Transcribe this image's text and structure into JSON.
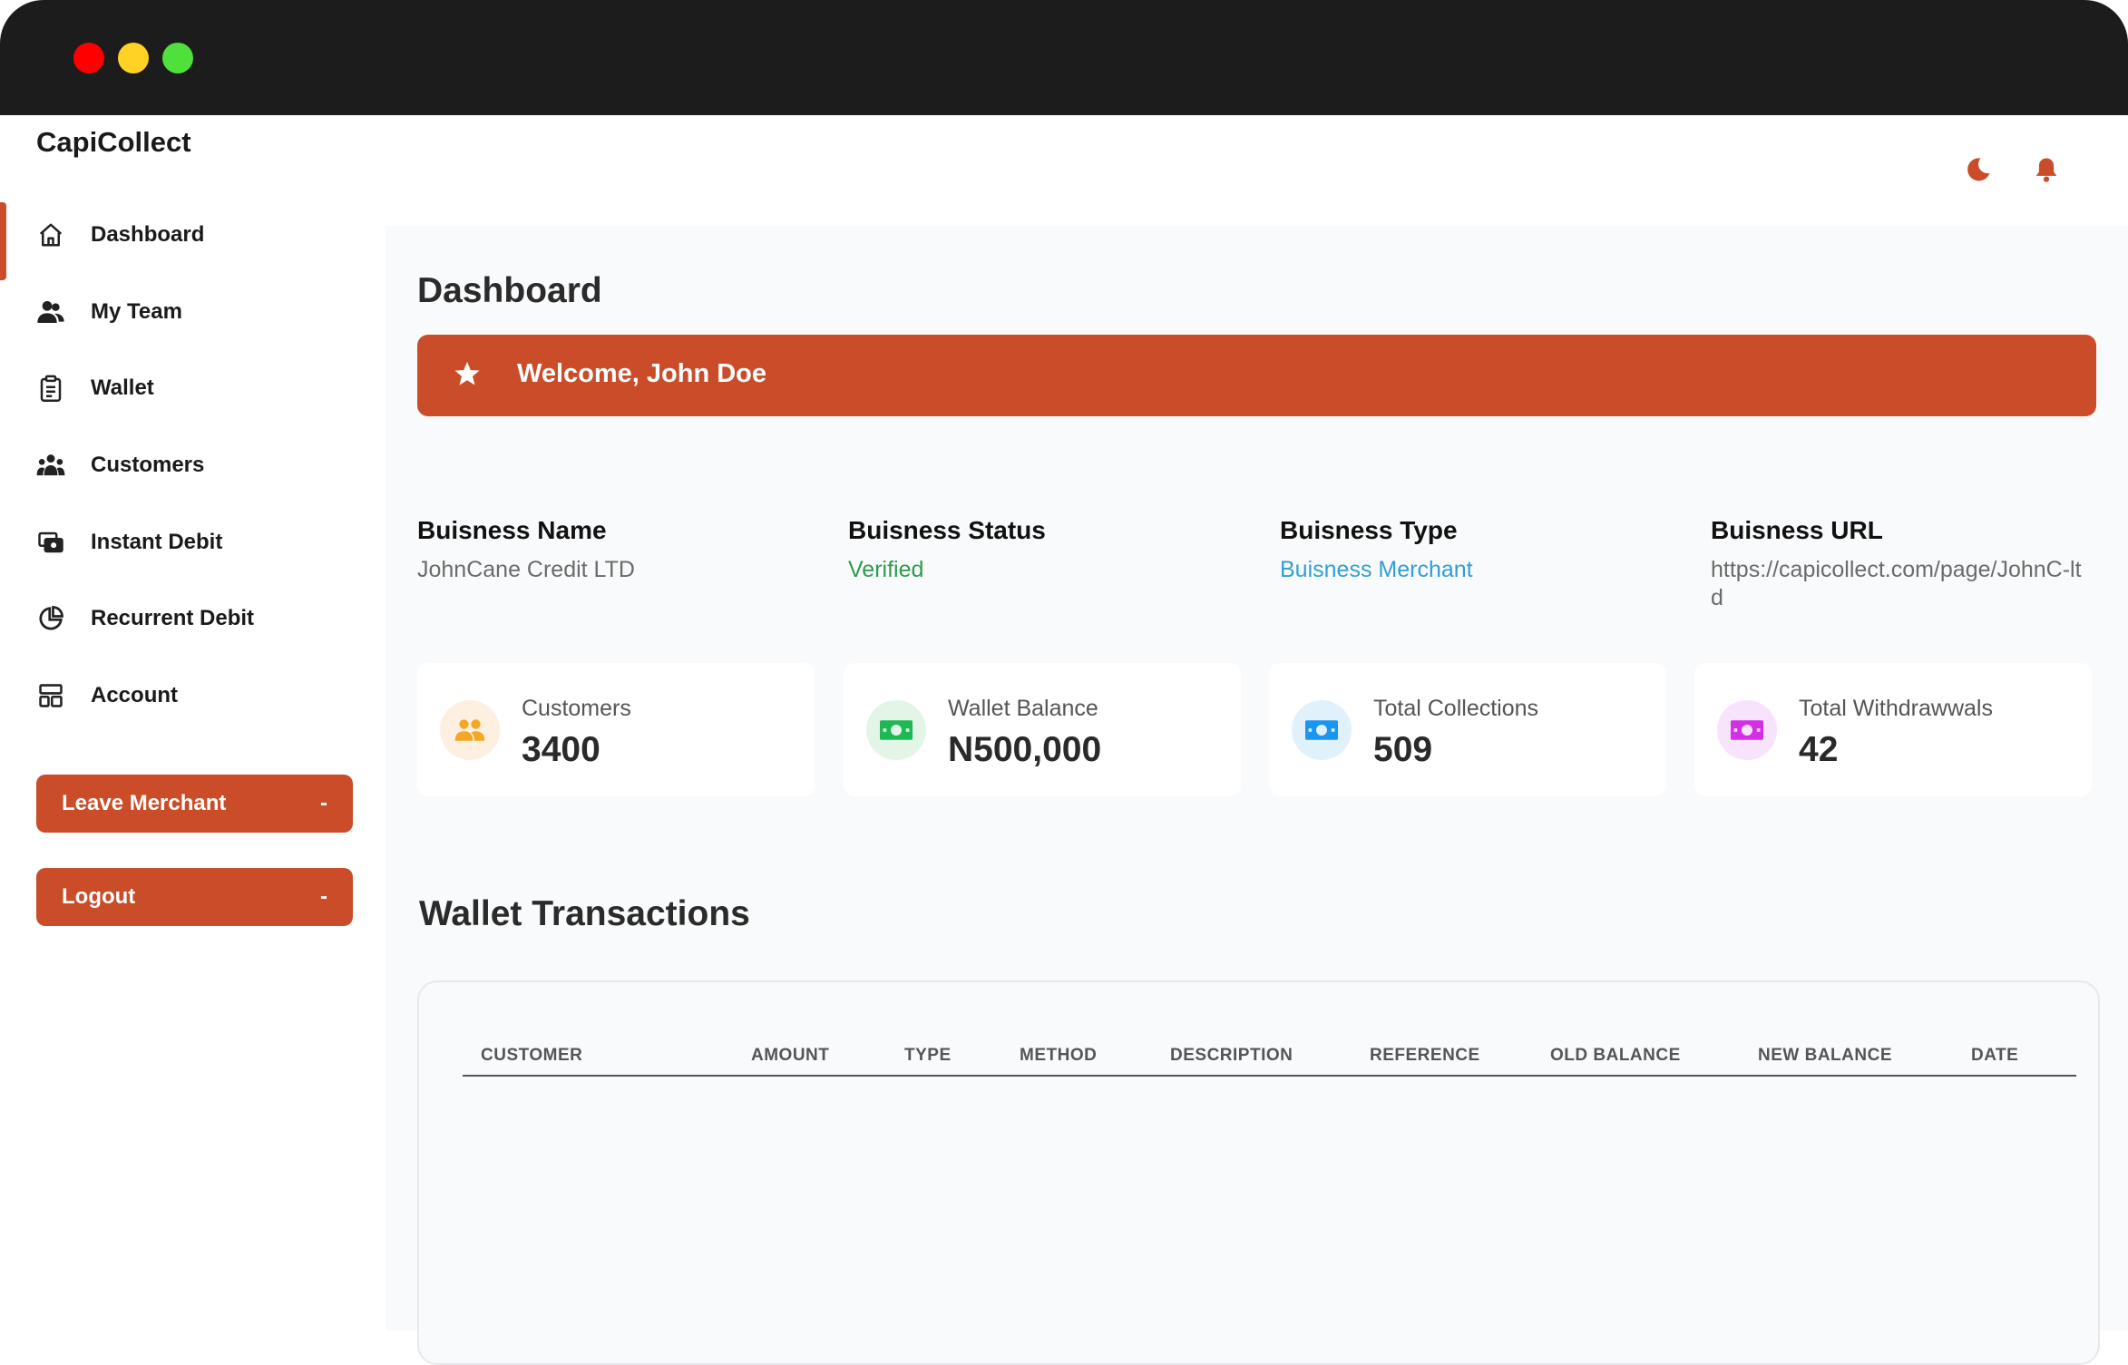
{
  "app": {
    "brand": "CapiCollect"
  },
  "sidebar": {
    "items": [
      {
        "label": "Dashboard",
        "icon": "home-icon",
        "active": true
      },
      {
        "label": "My Team",
        "icon": "team-icon"
      },
      {
        "label": "Wallet",
        "icon": "clipboard-icon"
      },
      {
        "label": "Customers",
        "icon": "customers-icon"
      },
      {
        "label": "Instant Debit",
        "icon": "cash-icon"
      },
      {
        "label": "Recurrent Debit",
        "icon": "pie-chart-icon"
      },
      {
        "label": "Account",
        "icon": "layout-icon"
      }
    ],
    "leave_merchant": {
      "label": "Leave Merchant",
      "suffix": "-"
    },
    "logout": {
      "label": "Logout",
      "suffix": "-"
    }
  },
  "header": {
    "icons": [
      "moon-icon",
      "bell-icon"
    ]
  },
  "main": {
    "title": "Dashboard",
    "welcome": "Welcome, John Doe",
    "business": {
      "name": {
        "label": "Buisness Name",
        "value": "JohnCane Credit LTD",
        "color": "#6b6b6b"
      },
      "status": {
        "label": "Buisness Status",
        "value": "Verified",
        "color": "#2e9b4f"
      },
      "type": {
        "label": "Buisness Type",
        "value": "Buisness Merchant",
        "color": "#2f9fd6"
      },
      "url": {
        "label": "Buisness URL",
        "value": "https://capicollect.com/page/JohnC-ltd",
        "color": "#6b6b6b"
      }
    },
    "stats": [
      {
        "label": "Customers",
        "value": "3400",
        "icon": "people-icon",
        "bg": "#fdf0e1",
        "fg": "#f5a623"
      },
      {
        "label": "Wallet Balance",
        "value": "N500,000",
        "icon": "money-icon",
        "bg": "#e3f5e7",
        "fg": "#1db954"
      },
      {
        "label": "Total Collections",
        "value": "509",
        "icon": "money-icon",
        "bg": "#e1f1fc",
        "fg": "#1a96f0"
      },
      {
        "label": "Total Withdrawwals",
        "value": "42",
        "icon": "money-icon",
        "bg": "#f7e3fb",
        "fg": "#d42ee6"
      }
    ],
    "transactions": {
      "title": "Wallet Transactions",
      "columns": [
        "CUSTOMER",
        "AMOUNT",
        "TYPE",
        "METHOD",
        "DESCRIPTION",
        "REFERENCE",
        "OLD BALANCE",
        "NEW BALANCE",
        "DATE"
      ],
      "rows": []
    }
  },
  "colors": {
    "accent": "#cb4c28",
    "titlebar": "#1c1c1c"
  }
}
